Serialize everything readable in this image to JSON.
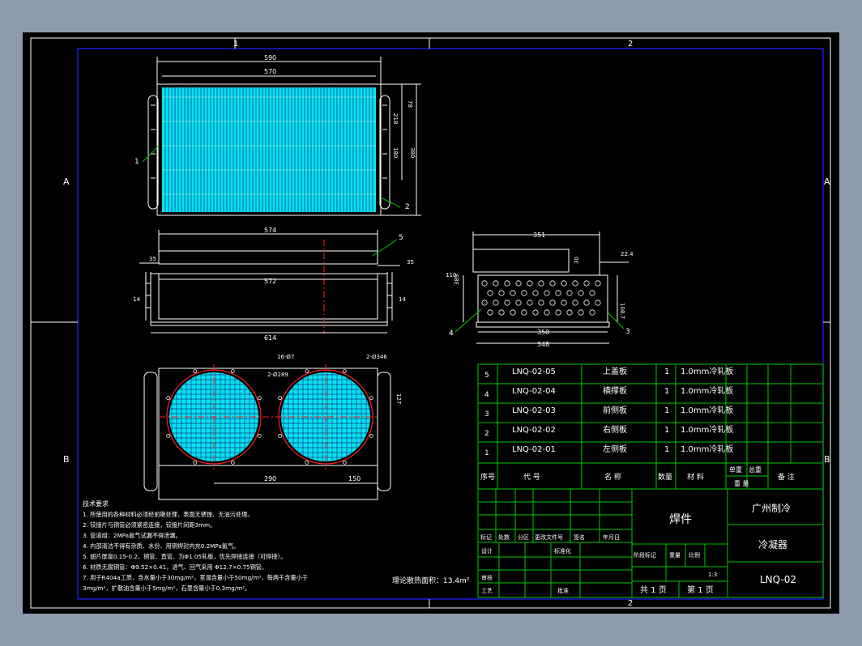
{
  "colors": {
    "background": "#8c9aab",
    "canvas": "#000000",
    "frame": "#2020ff",
    "line": "#ffffff",
    "table": "#00c800",
    "fins": "#00e5f0",
    "center_line": "#ff2020"
  },
  "zones": {
    "col1": "1",
    "col2": "2",
    "rowA": "A",
    "rowB": "B"
  },
  "dims": {
    "top_overall": "590",
    "top_inner": "570",
    "right_78": "78",
    "right_218": "218",
    "right_180": "180",
    "right_380": "380",
    "side_574": "574",
    "side_572": "572",
    "side_614": "614",
    "side_left_35": "35",
    "side_right_35": "35",
    "side_left_14": "14",
    "side_right_14": "14",
    "end_351": "351",
    "end_224": "22.4",
    "end_110": "110",
    "end_389": "389",
    "end_1087": "108.7",
    "end_350": "350",
    "end_348": "348",
    "end_30": "30",
    "fan_holes_left": "16-Ø7",
    "fan_holes_mid": "2-Ø289",
    "fan_holes_right": "2-Ø346",
    "fan_127": "127",
    "fan_290": "290",
    "fan_150": "150"
  },
  "callouts": [
    "1",
    "2",
    "3",
    "4",
    "5"
  ],
  "parts_list": [
    {
      "no": "5",
      "code": "LNQ-02-05",
      "name": "上盖板",
      "qty": "1",
      "material": "1.0mm冷轧板"
    },
    {
      "no": "4",
      "code": "LNQ-02-04",
      "name": "横撑板",
      "qty": "1",
      "material": "1.0mm冷轧板"
    },
    {
      "no": "3",
      "code": "LNQ-02-03",
      "name": "前侧板",
      "qty": "1",
      "material": "1.0mm冷轧板"
    },
    {
      "no": "2",
      "code": "LNQ-02-02",
      "name": "右侧板",
      "qty": "1",
      "material": "1.0mm冷轧板"
    },
    {
      "no": "1",
      "code": "LNQ-02-01",
      "name": "左侧板",
      "qty": "1",
      "material": "1.0mm冷轧板"
    }
  ],
  "parts_header": {
    "no": "序号",
    "code": "代 号",
    "name": "名 称",
    "qty": "数量",
    "material": "材 料",
    "unit_weight": "单重",
    "total_weight": "总重",
    "weight": "重 量",
    "remarks": "备 注"
  },
  "title_block": {
    "drawing_name": "焊件",
    "company": "广州制冷",
    "product": "冷凝器",
    "drawing_no": "LNQ-02",
    "rev_labels": [
      "标记",
      "处数",
      "分区",
      "更改文件号",
      "签名",
      "年月日"
    ],
    "design": "设计",
    "standardize": "标准化",
    "review": "审核",
    "process": "工艺",
    "approve": "批准",
    "stage_mark": "阶段标记",
    "weight": "重量",
    "scale": "比例",
    "scale_value": "1:3",
    "pages_total": "共 1 页",
    "page_no": "第 1 页"
  },
  "notes": {
    "title": "技术要求",
    "lines": [
      "1. 所使用的各种材料必须经前期处理，表面无锈蚀、无油污处理。",
      "2. 铰接片与铜管必须紧密连接，铰接片间距3mm。",
      "3. 管道组：2MPa氮气试漏不得泄漏。",
      "4. 内部清洁不得有杂质、水份、用铜焊封内充0.2MPa氮气。",
      "5. 翅片厚度0.15-0.2，铜管、直管、为Φ1.05轧板，优先焊接连接（可焊接）。",
      "6. 材质无腐铜管：Φ9.52×0.41，进气、回气采用 Φ12.7×0.75铜管。",
      "7. 用于R404a工质，含水量小于30mg/m²，室温含量小于50mg/m²，每两千含量小于",
      "3mg/m²，扩散油含量小于5mg/m²，石墨含量小于0.3mg/m²。"
    ]
  },
  "area_note": "理论散热面积：13.4m²"
}
